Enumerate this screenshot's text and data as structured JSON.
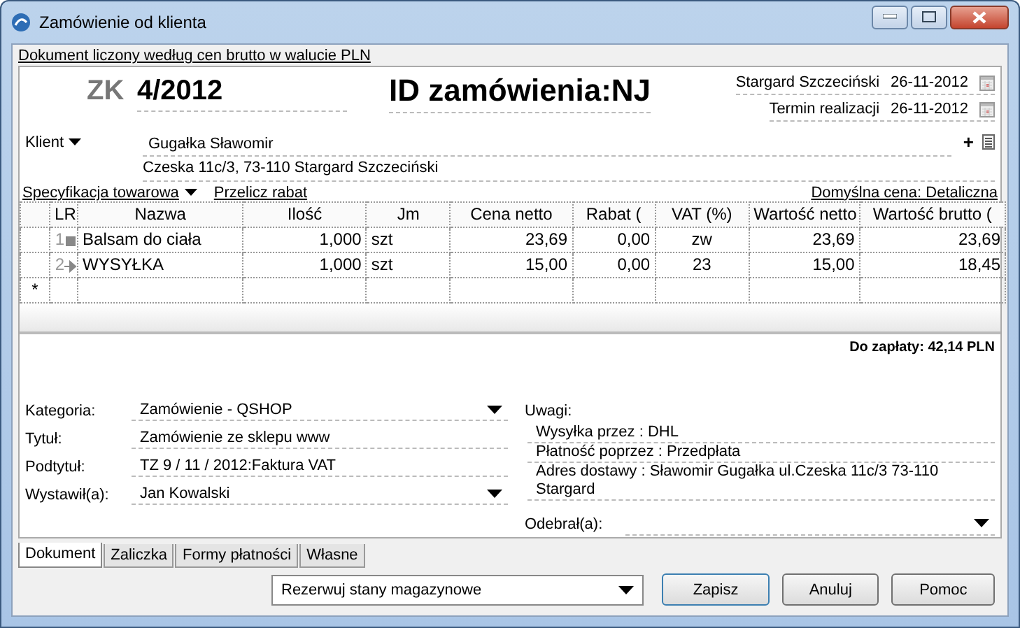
{
  "window": {
    "title": "Zamówienie od klienta"
  },
  "info_link": "Dokument liczony według cen brutto w walucie PLN",
  "document": {
    "prefix": "ZK",
    "number": "4/2012",
    "order_id": "ID zamówienia:NJ",
    "place": "Stargard Szczeciński",
    "date": "26-11-2012",
    "due_label": "Termin realizacji",
    "due_date": "26-11-2012"
  },
  "client": {
    "label": "Klient",
    "name": "Gugałka Sławomir",
    "address": "Czeska 11c/3, 73-110 Stargard Szczeciński",
    "add_icon": "+"
  },
  "spec_menu": "Specyfikacja towarowa",
  "recalc_link": "Przelicz rabat",
  "default_price": "Domyślna cena: Detaliczna",
  "table": {
    "columns": [
      "LR",
      "Nazwa",
      "Ilość",
      "Jm",
      "Cena netto",
      "Rabat (",
      "VAT (%)",
      "Wartość netto",
      "Wartość brutto ("
    ],
    "rows": [
      {
        "kind": "product",
        "cells": [
          "1",
          "Balsam do ciała",
          "1,000",
          "szt",
          "23,69",
          "0,00",
          "zw",
          "23,69",
          "23,69"
        ]
      },
      {
        "kind": "service",
        "cells": [
          "2",
          "WYSYŁKA",
          "1,000",
          "szt",
          "15,00",
          "0,00",
          "23",
          "15,00",
          "18,45"
        ]
      }
    ],
    "new_row_marker": "*"
  },
  "total": "Do zapłaty: 42,14 PLN",
  "fields": [
    {
      "label": "Kategoria:",
      "value": "Zamówienie - QSHOP",
      "kind": "dropdown"
    },
    {
      "label": "Tytuł:",
      "value": "Zamówienie ze sklepu www",
      "kind": "text"
    },
    {
      "label": "Podtytuł:",
      "value": "TZ 9 / 11 / 2012:Faktura VAT",
      "kind": "text"
    },
    {
      "label": "Wystawił(a):",
      "value": "Jan Kowalski",
      "kind": "dropdown"
    }
  ],
  "notes": {
    "label": "Uwagi:",
    "lines": [
      "Wysyłka przez : DHL",
      "Płatność poprzez : Przedpłata",
      "Adres dostawy : Sławomir Gugałka ul.Czeska 11c/3 73-110 Stargard"
    ]
  },
  "receiver": {
    "label": "Odebrał(a):"
  },
  "tabs": [
    {
      "label": "Dokument",
      "selected": true
    },
    {
      "label": "Zaliczka",
      "selected": false
    },
    {
      "label": "Formy płatności",
      "selected": false
    },
    {
      "label": "Własne",
      "selected": false
    }
  ],
  "reserve": {
    "value": "Rezerwuj stany magazynowe"
  },
  "buttons": [
    "Zapisz",
    "Anuluj",
    "Pomoc"
  ]
}
